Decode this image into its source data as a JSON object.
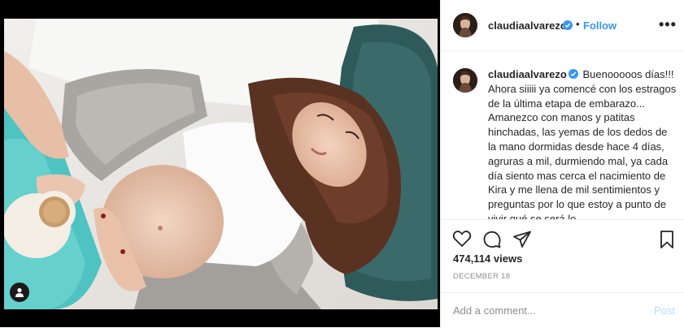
{
  "post": {
    "username": "claudiaalvarezo",
    "follow_label": "Follow",
    "separator": "•",
    "more_label": "•••",
    "caption_text": "Buenooooos días!!! Ahora siiiii ya comencé con los estragos de la última etapa de embarazo... Amanezco con manos y patitas hinchadas, las yemas de los dedos de la mano dormidas desde hace 4 días, agruras a mil, durmiendo mal, ya cada día siento mas cerca el nacimiento de Kira y me llena de mil sentimientos y preguntas por lo que estoy a punto de vivir qué se será lo",
    "views": "474,114 views",
    "date": "DECEMBER 18"
  },
  "comment": {
    "placeholder": "Add a comment...",
    "post_label": "Post"
  },
  "colors": {
    "accent": "#3897f0",
    "post_disabled": "#b2dffc"
  },
  "icons": [
    "user-tag-icon",
    "verified-badge-icon",
    "heart-icon",
    "comment-icon",
    "share-icon",
    "bookmark-icon",
    "more-options-icon"
  ]
}
